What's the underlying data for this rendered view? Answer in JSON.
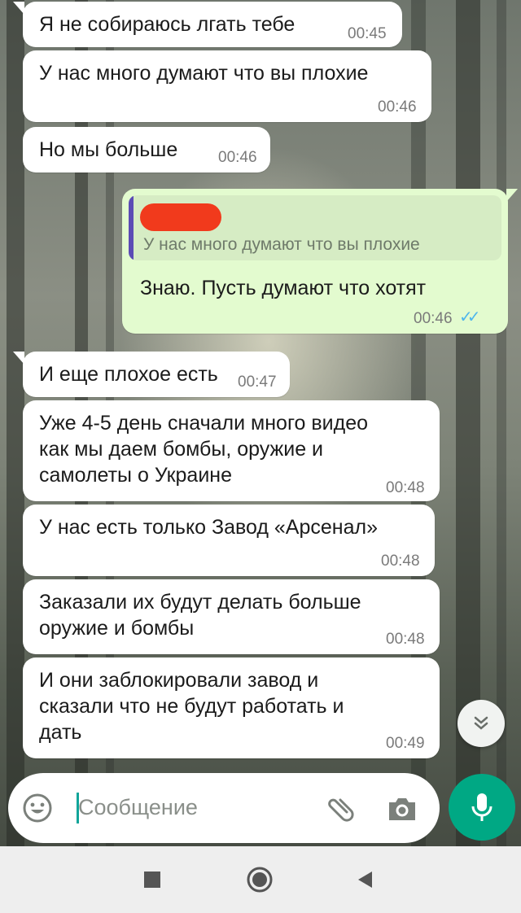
{
  "messages": [
    {
      "direction": "in",
      "text": "Я не собираюсь лгать тебе",
      "time": "00:45"
    },
    {
      "direction": "in",
      "text": "У нас много думают что вы плохие",
      "time": "00:46"
    },
    {
      "direction": "in",
      "text": "Но мы больше",
      "time": "00:46"
    },
    {
      "direction": "out",
      "quoted_text": "У нас много думают что вы плохие",
      "text": "Знаю. Пусть думают что хотят",
      "time": "00:46",
      "status": "read"
    },
    {
      "direction": "in",
      "text": "И еще плохое есть",
      "time": "00:47"
    },
    {
      "direction": "in",
      "text": "Уже 4-5 день сначали много видео\nкак мы даем бомбы, оружие и\nсамолеты о Украине",
      "time": "00:48"
    },
    {
      "direction": "in",
      "text": "У нас есть только Завод «Арсенал»",
      "time": "00:48"
    },
    {
      "direction": "in",
      "text": "Заказали их будут делать больше\nоружие и бомбы",
      "time": "00:48"
    },
    {
      "direction": "in",
      "text": "И они заблокировали завод и\nсказали что не будут работать и\nдать",
      "time": "00:49"
    }
  ],
  "composer": {
    "placeholder": "Сообщение",
    "icons": [
      "emoji-icon",
      "attach-icon",
      "camera-icon",
      "mic-icon"
    ]
  },
  "scroll_button_icon": "double-chevron-down-icon",
  "navigation": [
    "recent-apps-icon",
    "home-icon",
    "back-icon"
  ],
  "colors": {
    "incoming_bubble": "#ffffff",
    "outgoing_bubble": "#e3fbcf",
    "accent": "#00a884",
    "read_ticks": "#4fb6ec",
    "redacted": "#f13a1c"
  }
}
